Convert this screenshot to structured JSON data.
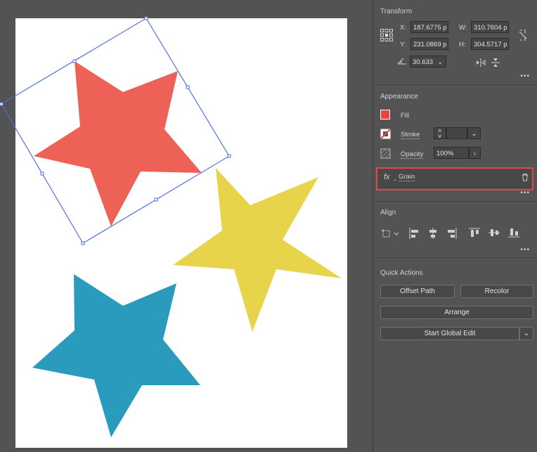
{
  "transform": {
    "title": "Transform",
    "x_label": "X:",
    "x_value": "187.6775 p",
    "y_label": "Y:",
    "y_value": "231.0869 p",
    "w_label": "W:",
    "w_value": "310.7604 p",
    "h_label": "H:",
    "h_value": "304.5717 p",
    "angle_value": "30.633",
    "more": "•••"
  },
  "appearance": {
    "title": "Appearance",
    "fill_label": "Fill",
    "fill_color": "#e8453c",
    "stroke_label": "Stroke",
    "opacity_label": "Opacity",
    "opacity_value": "100%",
    "effect_label": "Grain",
    "more": "•••"
  },
  "align": {
    "title": "Align",
    "more": "•••"
  },
  "quick_actions": {
    "title": "Quick Actions",
    "offset_path": "Offset Path",
    "recolor": "Recolor",
    "arrange": "Arrange",
    "start_global_edit": "Start Global Edit"
  },
  "colors": {
    "red_star": "#ed6156",
    "yellow_star": "#e8d44a",
    "blue_star": "#2a9bbd",
    "selection": "#4d6ee0",
    "highlight": "#e64543"
  }
}
